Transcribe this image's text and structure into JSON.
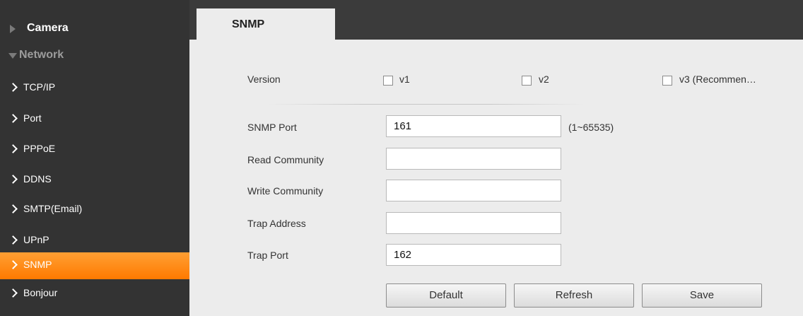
{
  "sidebar": {
    "categories": [
      {
        "label": "Camera",
        "expanded": false
      },
      {
        "label": "Network",
        "expanded": true
      }
    ],
    "items": [
      {
        "label": "TCP/IP"
      },
      {
        "label": "Port"
      },
      {
        "label": "PPPoE"
      },
      {
        "label": "DDNS"
      },
      {
        "label": "SMTP(Email)"
      },
      {
        "label": "UPnP"
      },
      {
        "label": "SNMP",
        "active": true
      },
      {
        "label": "Bonjour"
      }
    ]
  },
  "tabs": [
    {
      "label": "SNMP",
      "active": true
    }
  ],
  "form": {
    "version": {
      "label": "Version",
      "options": [
        {
          "label": "v1",
          "checked": false
        },
        {
          "label": "v2",
          "checked": false
        },
        {
          "label": "v3 (Recommen…",
          "checked": false
        }
      ]
    },
    "snmp_port": {
      "label": "SNMP Port",
      "value": "161",
      "hint": "(1~65535)"
    },
    "read_community": {
      "label": "Read Community",
      "value": ""
    },
    "write_community": {
      "label": "Write Community",
      "value": ""
    },
    "trap_address": {
      "label": "Trap Address",
      "value": ""
    },
    "trap_port": {
      "label": "Trap Port",
      "value": "162"
    }
  },
  "buttons": {
    "default": "Default",
    "refresh": "Refresh",
    "save": "Save"
  },
  "colors": {
    "sidebar_bg": "#333333",
    "active_item": "#ff8c1a",
    "content_bg": "#ececec",
    "topbar_bg": "#3b3b3b"
  }
}
